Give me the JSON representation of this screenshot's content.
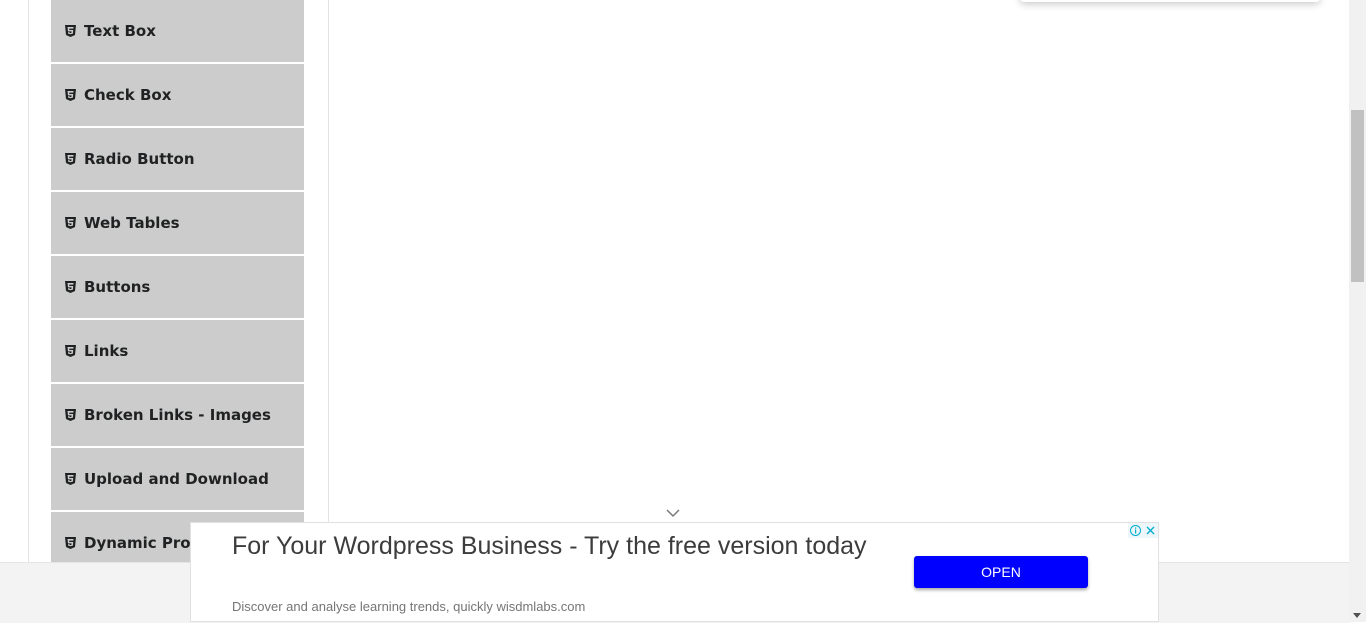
{
  "sidebar": {
    "items": [
      {
        "label": "Text Box",
        "icon": "html5-icon"
      },
      {
        "label": "Check Box",
        "icon": "html5-icon"
      },
      {
        "label": "Radio Button",
        "icon": "html5-icon"
      },
      {
        "label": "Web Tables",
        "icon": "html5-icon"
      },
      {
        "label": "Buttons",
        "icon": "html5-icon"
      },
      {
        "label": "Links",
        "icon": "html5-icon"
      },
      {
        "label": "Broken Links - Images",
        "icon": "html5-icon"
      },
      {
        "label": "Upload and Download",
        "icon": "html5-icon"
      },
      {
        "label": "Dynamic Properties",
        "icon": "html5-icon"
      }
    ]
  },
  "ad": {
    "headline": "For Your Wordpress Business - Try the free version today",
    "subtext": "Discover and analyse learning trends, quickly wisdmlabs.com",
    "button_label": "OPEN",
    "button_color": "#0000ff",
    "controls": [
      "info-icon",
      "close-icon"
    ]
  }
}
